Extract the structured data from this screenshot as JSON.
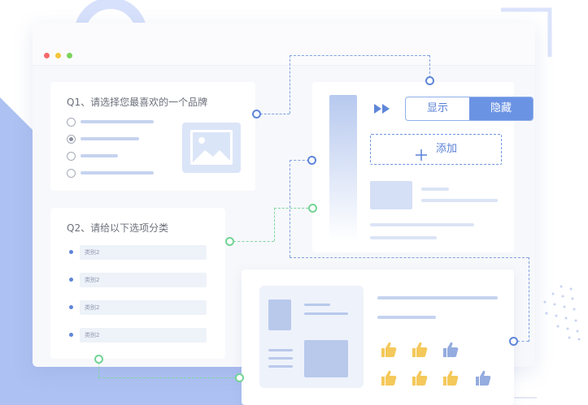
{
  "window_controls": {
    "close": "#f46a6a",
    "minimize": "#f5c53b",
    "maximize": "#7bd35b"
  },
  "survey": {
    "q1": {
      "title": "Q1、请选择您最喜欢的一个品牌",
      "options_count": 4,
      "selected_index": 1
    },
    "q2": {
      "title": "Q2、请给以下选项分类",
      "chips": [
        "类别2",
        "类别2",
        "类别2",
        "类别2"
      ]
    }
  },
  "logic_panel": {
    "toggle": {
      "show_label": "显示",
      "hide_label": "隐藏",
      "active": "隐藏"
    },
    "add_label": "添加",
    "add_icon": "plus-icon",
    "arrow_icon": "double-chevron-right-icon"
  },
  "rating": {
    "thumb_icon": "thumbs-up-icon",
    "gold_count": 5,
    "blue_count": 2
  },
  "colors": {
    "accent": "#6b93e4",
    "accent_dark": "#5a80d6",
    "gold": "#f4c85a",
    "blue_thumb": "#94acdf",
    "green_connector": "#72d495"
  }
}
